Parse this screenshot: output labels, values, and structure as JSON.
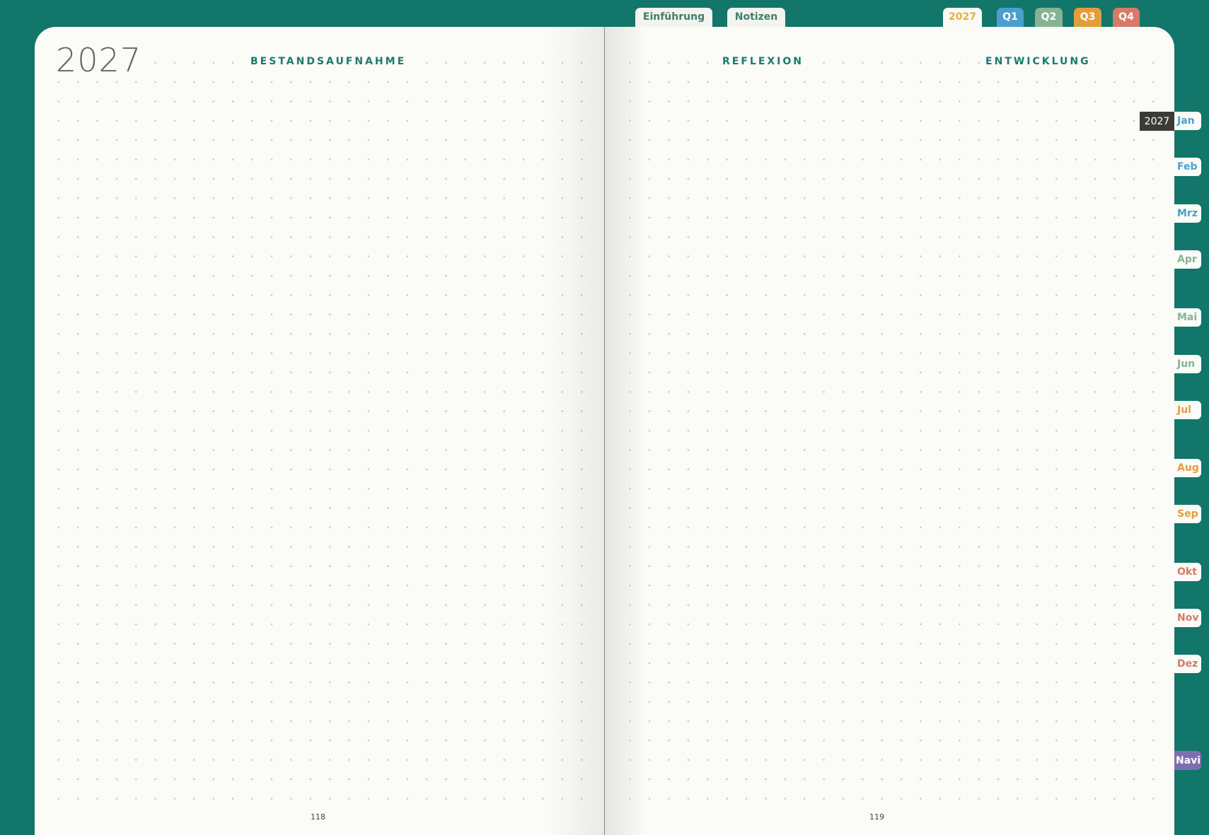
{
  "top_tabs": {
    "einfuehrung": "Einführung",
    "notizen": "Notizen",
    "year": "2027",
    "q1": "Q1",
    "q2": "Q2",
    "q3": "Q3",
    "q4": "Q4"
  },
  "left_page": {
    "year_title": "2027",
    "section": "BESTANDSAUFNAHME",
    "page_number": "118"
  },
  "right_page": {
    "section_1": "REFLEXION",
    "section_2": "ENTWICKLUNG",
    "page_number": "119"
  },
  "side": {
    "year_badge": "2027",
    "months": [
      "Jan",
      "Feb",
      "Mrz",
      "Apr",
      "Mai",
      "Jun",
      "Jul",
      "Aug",
      "Sep",
      "Okt",
      "Nov",
      "Dez"
    ],
    "navi": "Navi"
  },
  "colors": {
    "background": "#12766a",
    "paper": "#fbfbf8",
    "q1": "#4a9fce",
    "q2": "#86b393",
    "q3": "#e59d3b",
    "q4": "#d77a67",
    "year_tab": "#e2b23d",
    "navi": "#7f6db0",
    "section_title": "#1c7a6b"
  }
}
